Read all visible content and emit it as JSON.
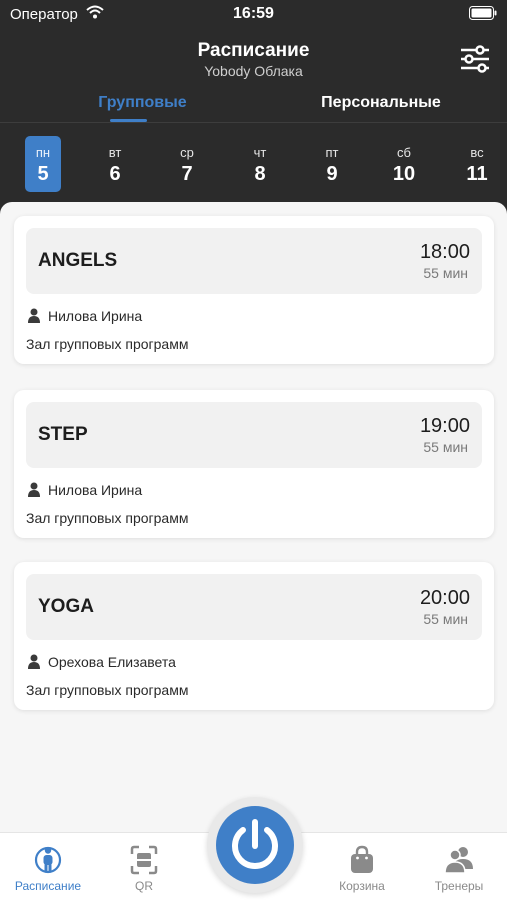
{
  "status_bar": {
    "carrier": "Оператор",
    "time": "16:59"
  },
  "header": {
    "title": "Расписание",
    "subtitle": "Yobody Облака"
  },
  "tabs": [
    {
      "label": "Групповые",
      "active": true
    },
    {
      "label": "Персональные",
      "active": false
    }
  ],
  "days": [
    {
      "name": "пн",
      "date": "5",
      "active": true
    },
    {
      "name": "вт",
      "date": "6",
      "active": false
    },
    {
      "name": "ср",
      "date": "7",
      "active": false
    },
    {
      "name": "чт",
      "date": "8",
      "active": false
    },
    {
      "name": "пт",
      "date": "9",
      "active": false
    },
    {
      "name": "сб",
      "date": "10",
      "active": false
    },
    {
      "name": "вс",
      "date": "11",
      "active": false
    }
  ],
  "classes": [
    {
      "name": "ANGELS",
      "time": "18:00",
      "duration": "55 мин",
      "trainer": "Нилова Ирина",
      "room": "Зал групповых программ"
    },
    {
      "name": "STEP",
      "time": "19:00",
      "duration": "55 мин",
      "trainer": "Нилова Ирина",
      "room": "Зал групповых программ"
    },
    {
      "name": "YOGA",
      "time": "20:00",
      "duration": "55 мин",
      "trainer": "Орехова Елизавета",
      "room": "Зал групповых программ"
    }
  ],
  "tabbar": [
    {
      "label": "Расписание",
      "icon": "schedule-person-icon",
      "active": true
    },
    {
      "label": "QR",
      "icon": "qr-scan-icon",
      "active": false
    },
    {
      "label": "",
      "icon": "power-icon",
      "active": false
    },
    {
      "label": "Корзина",
      "icon": "shopping-bag-icon",
      "active": false
    },
    {
      "label": "Тренеры",
      "icon": "trainers-icon",
      "active": false
    }
  ],
  "colors": {
    "accent": "#3f7fc8",
    "header_bg": "#2b2b2b",
    "content_bg": "#f6f6f6"
  }
}
